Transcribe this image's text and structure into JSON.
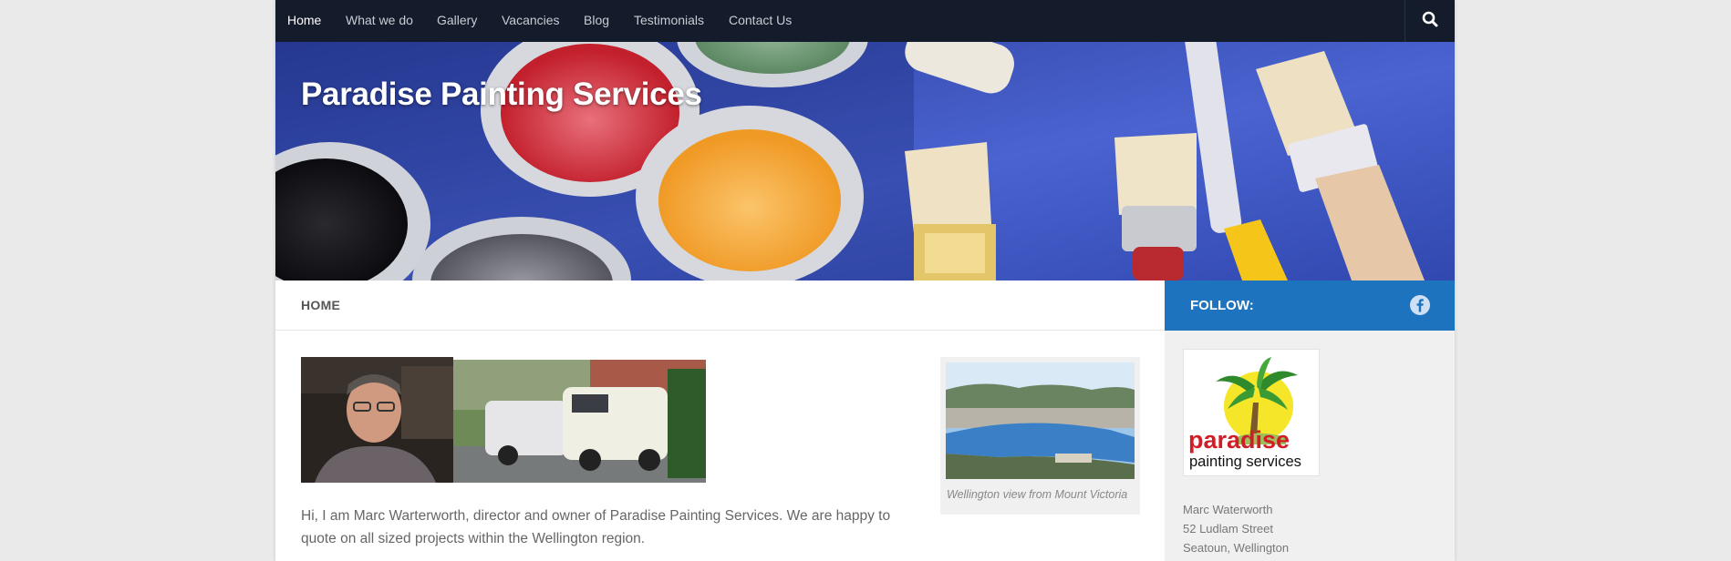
{
  "nav": {
    "items": [
      {
        "label": "Home",
        "active": true
      },
      {
        "label": "What we do"
      },
      {
        "label": "Gallery"
      },
      {
        "label": "Vacancies"
      },
      {
        "label": "Blog"
      },
      {
        "label": "Testimonials"
      },
      {
        "label": "Contact Us"
      }
    ],
    "search_icon": "search-icon"
  },
  "header": {
    "site_title": "Paradise Painting Services"
  },
  "main": {
    "breadcrumb": "HOME",
    "intro_line1": "Hi, I am Marc Warterworth, director and owner of Paradise Painting Services.  We are happy to",
    "intro_line2": "quote on all sized projects within the Wellington region.",
    "figure_caption": "Wellington view from Mount Victoria"
  },
  "sidebar": {
    "follow_label": "FOLLOW:",
    "follow_icon": "facebook-icon",
    "logo": {
      "word": "paradise",
      "sub": "painting services"
    },
    "address": [
      "Marc Waterworth",
      "52 Ludlam Street",
      "Seatoun, Wellington"
    ]
  },
  "colors": {
    "nav_bg": "#141c2c",
    "accent_blue": "#1e73be",
    "header_bg": "#3c55c4"
  }
}
